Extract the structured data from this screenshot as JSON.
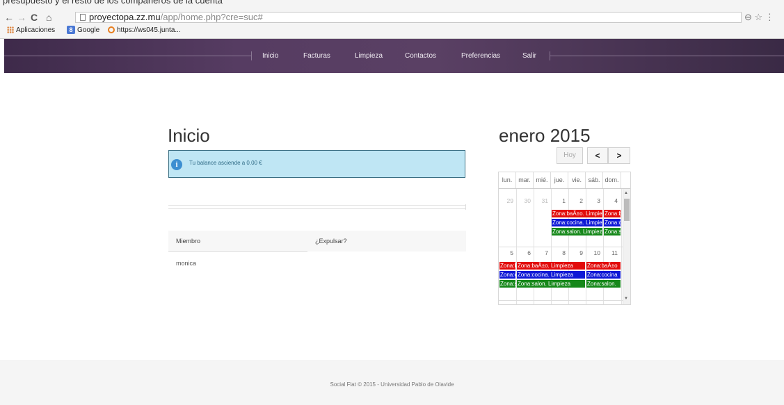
{
  "browser": {
    "cut_text": "presupuesto y el resto de los compañeros de la cuenta",
    "url_host": "proyectopa.zz.mu",
    "url_path": "/app/home.php?cre=suc#",
    "bookmarks": [
      {
        "label": "Aplicaciones",
        "icon": "apps-grid-icon"
      },
      {
        "label": "Google",
        "icon": "google-icon"
      },
      {
        "label": "https://ws045.junta...",
        "icon": "clock-icon"
      }
    ]
  },
  "nav": {
    "items": [
      "Inicio",
      "Facturas",
      "Limpieza",
      "Contactos",
      "Preferencias",
      "Salir"
    ]
  },
  "main": {
    "title": "Inicio",
    "alert_text": "Tu balance asciende a 0.00 €",
    "table": {
      "headers": [
        "Miembro",
        "¿Expulsar?"
      ],
      "rows": [
        [
          "monica",
          ""
        ]
      ]
    }
  },
  "calendar": {
    "title": "enero 2015",
    "today_label": "Hoy",
    "prev_label": "<",
    "next_label": ">",
    "weekdays": [
      "lun.",
      "mar.",
      "mié.",
      "jue.",
      "vie.",
      "sáb.",
      "dom."
    ],
    "weeks": [
      {
        "days": [
          "29",
          "30",
          "31",
          "1",
          "2",
          "3",
          "4"
        ],
        "other_month": [
          true,
          true,
          true,
          false,
          false,
          false,
          false
        ]
      },
      {
        "days": [
          "5",
          "6",
          "7",
          "8",
          "9",
          "10",
          "11"
        ],
        "other_month": [
          false,
          false,
          false,
          false,
          false,
          false,
          false
        ]
      }
    ],
    "events": [
      {
        "week": 0,
        "from": 3,
        "to": 5,
        "row": 0,
        "color": "red",
        "label": "Zona:baÃ±o. Limpieza"
      },
      {
        "week": 0,
        "from": 6,
        "to": 6,
        "row": 0,
        "color": "red",
        "label": "Zona:baÃ±o"
      },
      {
        "week": 0,
        "from": 3,
        "to": 5,
        "row": 1,
        "color": "blue",
        "label": "Zona:cocina. Limpieza"
      },
      {
        "week": 0,
        "from": 6,
        "to": 6,
        "row": 1,
        "color": "blue",
        "label": "Zona:cocina"
      },
      {
        "week": 0,
        "from": 3,
        "to": 5,
        "row": 2,
        "color": "green",
        "label": "Zona:salon. Limpieza"
      },
      {
        "week": 0,
        "from": 6,
        "to": 6,
        "row": 2,
        "color": "green",
        "label": "Zona:salon"
      },
      {
        "week": 1,
        "from": 0,
        "to": 0,
        "row": 0,
        "color": "red",
        "label": "Zona:baÃ±o"
      },
      {
        "week": 1,
        "from": 1,
        "to": 4,
        "row": 0,
        "color": "red",
        "label": "Zona:baÃ±o. Limpieza"
      },
      {
        "week": 1,
        "from": 5,
        "to": 6,
        "row": 0,
        "color": "red",
        "label": "Zona:baÃ±o"
      },
      {
        "week": 1,
        "from": 0,
        "to": 0,
        "row": 1,
        "color": "blue",
        "label": "Zona:cocina"
      },
      {
        "week": 1,
        "from": 1,
        "to": 4,
        "row": 1,
        "color": "blue",
        "label": "Zona:cocina. Limpieza"
      },
      {
        "week": 1,
        "from": 5,
        "to": 6,
        "row": 1,
        "color": "blue",
        "label": "Zona:cocina"
      },
      {
        "week": 1,
        "from": 0,
        "to": 0,
        "row": 2,
        "color": "green",
        "label": "Zona:salon."
      },
      {
        "week": 1,
        "from": 1,
        "to": 4,
        "row": 2,
        "color": "green",
        "label": "Zona:salon. Limpieza"
      },
      {
        "week": 1,
        "from": 5,
        "to": 6,
        "row": 2,
        "color": "green",
        "label": "Zona:salon."
      }
    ]
  },
  "footer": {
    "text": "Social Flat © 2015 - Universidad Pablo de Olavide"
  },
  "colors": {
    "nav_bg": "#563c62",
    "alert_bg": "#bfe6f4",
    "event_red": "#e20b0b",
    "event_blue": "#0e18d6",
    "event_green": "#16881a"
  }
}
